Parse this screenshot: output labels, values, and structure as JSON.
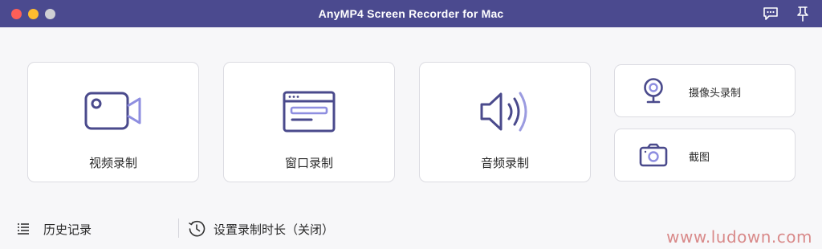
{
  "window": {
    "title": "AnyMP4 Screen Recorder for Mac"
  },
  "toolbar_icons": [
    "chat-icon",
    "pin-icon"
  ],
  "main_modes": [
    {
      "label": "视频录制",
      "icon": "video-camera-icon"
    },
    {
      "label": "窗口录制",
      "icon": "window-icon"
    },
    {
      "label": "音频录制",
      "icon": "speaker-icon"
    }
  ],
  "side_modes": [
    {
      "label": "摄像头录制",
      "icon": "webcam-icon"
    },
    {
      "label": "截图",
      "icon": "camera-icon"
    }
  ],
  "bottom": {
    "history_label": "历史记录",
    "duration_label": "设置录制时长（关闭）"
  },
  "watermark": "www.ludown.com",
  "colors": {
    "titlebar": "#4b4a8f",
    "accent": "#4a4a8c",
    "accent_light": "#9b9be0"
  }
}
